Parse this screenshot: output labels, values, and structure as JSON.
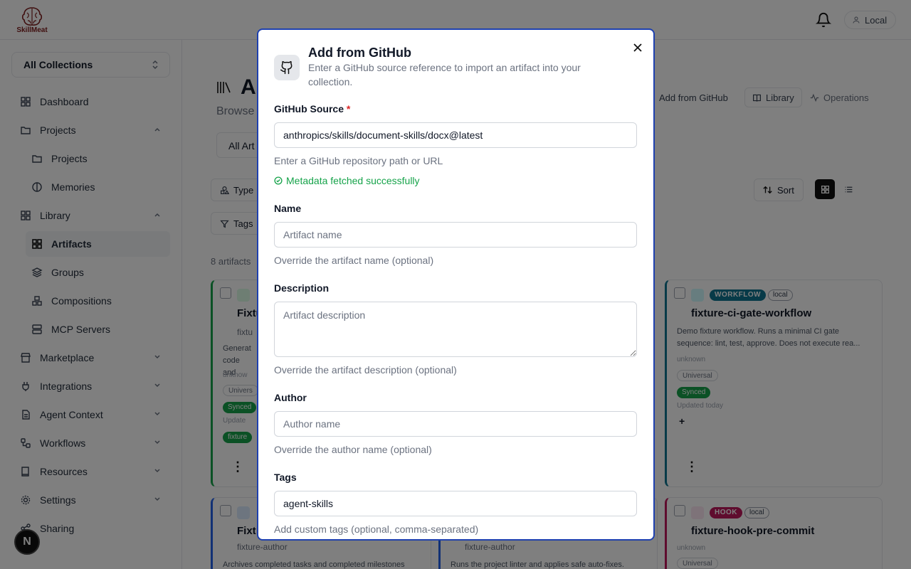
{
  "app": {
    "logo_text": "SkillMeat",
    "env_label": "Local",
    "avatar_letter": "N"
  },
  "sidebar": {
    "collection_selector": "All Collections",
    "items": [
      {
        "label": "Dashboard",
        "icon": "grid-icon"
      },
      {
        "label": "Projects",
        "icon": "folder-icon"
      },
      {
        "label": "Projects",
        "icon": "folder-icon"
      },
      {
        "label": "Memories",
        "icon": "brain-icon"
      },
      {
        "label": "Library",
        "icon": "grid-icon"
      },
      {
        "label": "Artifacts",
        "icon": "grid-icon"
      },
      {
        "label": "Groups",
        "icon": "layers-icon"
      },
      {
        "label": "Compositions",
        "icon": "blocks-icon"
      },
      {
        "label": "MCP Servers",
        "icon": "server-icon"
      },
      {
        "label": "Marketplace",
        "icon": "store-icon"
      },
      {
        "label": "Integrations",
        "icon": "plug-icon"
      },
      {
        "label": "Agent Context",
        "icon": "file-icon"
      },
      {
        "label": "Workflows",
        "icon": "workflow-icon"
      },
      {
        "label": "Resources",
        "icon": "book-icon"
      },
      {
        "label": "Settings",
        "icon": "gear-icon"
      },
      {
        "label": "Sharing",
        "icon": "share-icon"
      }
    ]
  },
  "main": {
    "title": "A",
    "subtitle": "Browse",
    "tab_label": "All Art",
    "header_buttons": {
      "add_github": "Add from GitHub",
      "library": "Library",
      "operations": "Operations"
    },
    "filters": {
      "type": "Type",
      "tags": "Tags",
      "sort": "Sort"
    },
    "count_text": "8 artifacts",
    "cards": [
      {
        "title": "Fixtu",
        "author": "fixtu",
        "desc": "Generat code and",
        "meta": "unknow",
        "scope": "Univers",
        "status": "Synced",
        "updated": "Update",
        "tag": "fixture"
      },
      {
        "type": "WORKFLOW",
        "source": "local",
        "title": "fixture-ci-gate-workflow",
        "desc": "Demo fixture workflow. Runs a minimal CI gate sequence: lint, test, approve. Does not execute rea...",
        "meta": "unknown",
        "scope": "Universal",
        "status": "Synced",
        "updated": "Updated today"
      },
      {
        "title": "Fixt",
        "author": "fixture-author",
        "desc": "Archives completed tasks and completed milestones"
      },
      {
        "author": "fixture-author",
        "desc": "Runs the project linter and applies safe auto-fixes."
      },
      {
        "type": "HOOK",
        "source": "local",
        "title": "fixture-hook-pre-commit",
        "meta": "unknown",
        "scope": "Universal"
      }
    ]
  },
  "modal": {
    "title": "Add from GitHub",
    "description": "Enter a GitHub source reference to import an artifact into your collection.",
    "fields": {
      "source": {
        "label": "GitHub Source",
        "required_mark": "*",
        "value": "anthropics/skills/document-skills/docx@latest",
        "help": "Enter a GitHub repository path or URL",
        "success": "Metadata fetched successfully"
      },
      "name": {
        "label": "Name",
        "placeholder": "Artifact name",
        "help": "Override the artifact name (optional)"
      },
      "description": {
        "label": "Description",
        "placeholder": "Artifact description",
        "help": "Override the artifact description (optional)"
      },
      "author": {
        "label": "Author",
        "placeholder": "Author name",
        "help": "Override the author name (optional)"
      },
      "tags": {
        "label": "Tags",
        "value": "agent-skills",
        "help": "Add custom tags (optional, comma-separated)"
      }
    }
  },
  "colors": {
    "modal_border": "#1e40af",
    "success": "#16a34a",
    "required": "#dc2626",
    "workflow_badge": "#0e7490",
    "hook_badge": "#be185d",
    "synced_badge": "#16a34a"
  }
}
